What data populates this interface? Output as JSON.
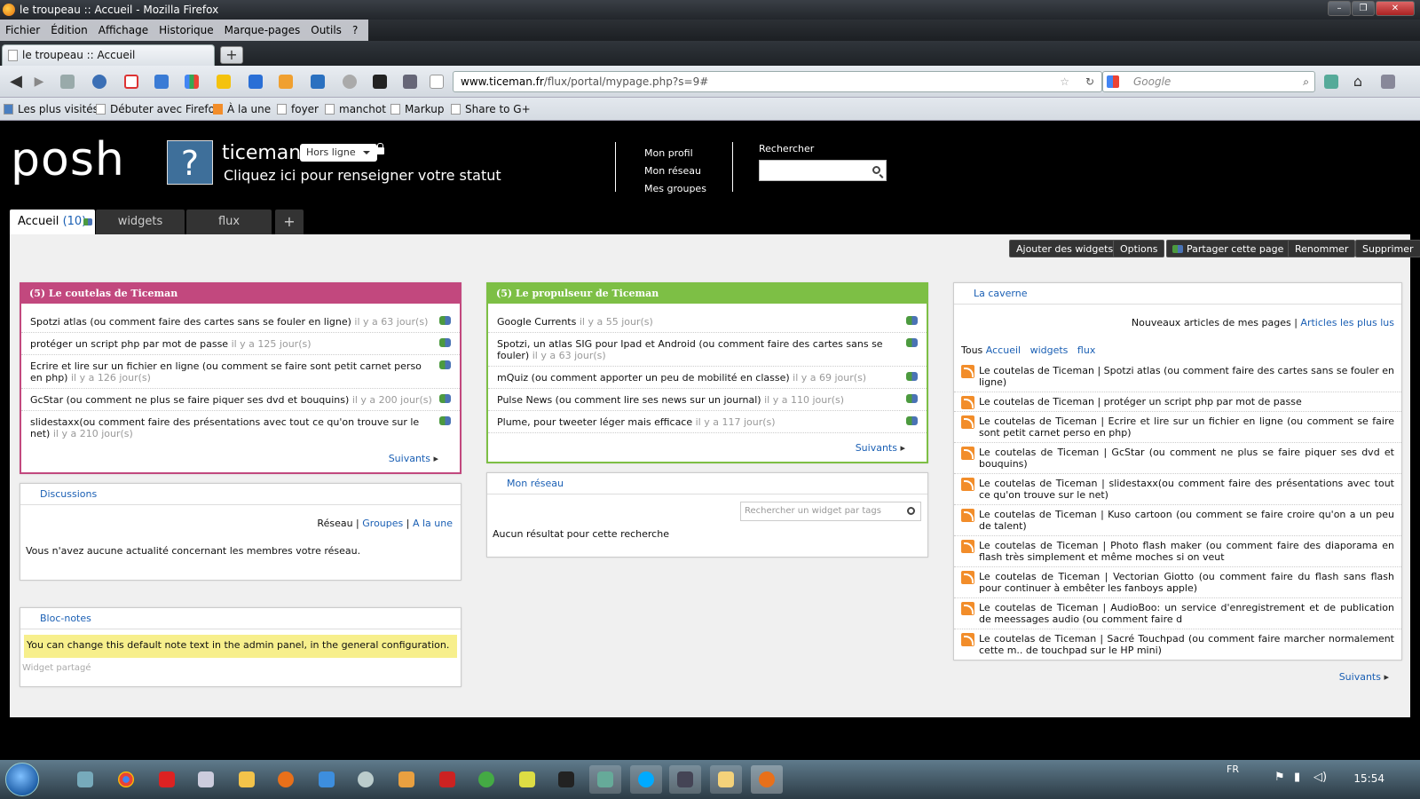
{
  "window": {
    "title": "le troupeau :: Accueil - Mozilla Firefox"
  },
  "menu": [
    "Fichier",
    "Édition",
    "Affichage",
    "Historique",
    "Marque-pages",
    "Outils",
    "?"
  ],
  "browser_tab": {
    "label": "le troupeau :: Accueil",
    "new_tab": "+"
  },
  "url": {
    "domain": "www.ticeman.fr",
    "path": "/flux/portal/mypage.php?s=9#"
  },
  "search_placeholder": "Google",
  "bookmarks": [
    "Les plus visités",
    "Débuter avec Firefox",
    "À la une",
    "foyer",
    "manchot",
    "Markup",
    "Share to G+"
  ],
  "site": {
    "logo": "posh",
    "username": "ticeman",
    "status": "Hors ligne",
    "status_prompt": "Cliquez ici pour renseigner votre statut",
    "links": [
      "Mon profil",
      "Mon réseau",
      "Mes groupes"
    ],
    "search_label": "Rechercher"
  },
  "tabs": [
    {
      "label": "Accueil",
      "count": "(10)"
    },
    {
      "label": "widgets"
    },
    {
      "label": "flux"
    },
    {
      "label": "+"
    }
  ],
  "actions": [
    "Ajouter des widgets",
    "Options",
    "Partager cette page",
    "Renommer",
    "Supprimer"
  ],
  "widget_coutelas": {
    "title": "(5) Le coutelas de Ticeman",
    "color": "#c2487e",
    "items": [
      {
        "text": "Spotzi atlas (ou comment faire des cartes sans se fouler en ligne)",
        "age": "il y a 63 jour(s)"
      },
      {
        "text": "protéger un script php par mot de passe",
        "age": "il y a 125 jour(s)"
      },
      {
        "text": "Ecrire et lire sur un fichier en ligne (ou comment se faire sont petit carnet perso en php)",
        "age": "il y a 126 jour(s)"
      },
      {
        "text": "GcStar (ou comment ne plus se faire piquer ses dvd et bouquins)",
        "age": "il y a 200 jour(s)"
      },
      {
        "text": "slidestaxx(ou comment faire des présentations avec tout ce qu'on trouve sur le net)",
        "age": "il y a 210 jour(s)"
      }
    ],
    "more": "Suivants"
  },
  "widget_propulseur": {
    "title": "(5) Le propulseur de Ticeman",
    "color": "#7dbf45",
    "items": [
      {
        "text": "Google Currents",
        "age": "il y a 55 jour(s)"
      },
      {
        "text": "Spotzi, un atlas SIG pour Ipad et Android (ou comment faire des cartes sans se fouler)",
        "age": "il y a 63 jour(s)"
      },
      {
        "text": "mQuiz (ou comment apporter un peu de mobilité en classe)",
        "age": "il y a 69 jour(s)"
      },
      {
        "text": "Pulse News (ou comment lire ses news sur un journal)",
        "age": "il y a 110 jour(s)"
      },
      {
        "text": "Plume, pour tweeter léger mais efficace",
        "age": "il y a 117 jour(s)"
      }
    ],
    "more": "Suivants"
  },
  "widget_discussions": {
    "title": "Discussions",
    "filter_reseau": "Réseau",
    "filter_groupes": "Groupes",
    "filter_une": "A la une",
    "empty": "Vous n'avez aucune actualité concernant les membres votre réseau."
  },
  "widget_reseau": {
    "title": "Mon réseau",
    "placeholder": "Rechercher un widget par tags",
    "empty": "Aucun résultat pour cette recherche"
  },
  "widget_notes": {
    "title": "Bloc-notes",
    "note": "You can change this default note text in the admin panel, in the general configuration.",
    "shared": "Widget partagé"
  },
  "widget_caverne": {
    "title": "La caverne",
    "heading": "Nouveaux articles de mes pages",
    "heading_link": "Articles les plus lus",
    "filters": [
      "Tous",
      "Accueil",
      "widgets",
      "flux"
    ],
    "items": [
      "Le coutelas de Ticeman | Spotzi atlas (ou comment faire des cartes sans se fouler en ligne)",
      "Le coutelas de Ticeman | protéger un script php par mot de passe",
      "Le coutelas de Ticeman | Ecrire et lire sur un fichier en ligne (ou comment se faire sont petit carnet perso en php)",
      "Le coutelas de Ticeman | GcStar (ou comment ne plus se faire piquer ses dvd et bouquins)",
      "Le coutelas de Ticeman | slidestaxx(ou comment faire des présentations avec tout ce qu'on trouve sur le net)",
      "Le coutelas de Ticeman | Kuso cartoon (ou comment se faire croire qu'on a un peu de talent)",
      "Le coutelas de Ticeman | Photo flash maker (ou comment faire des diaporama en flash très simplement et même moches si on veut",
      "Le coutelas de Ticeman | Vectorian Giotto (ou comment faire du flash sans flash pour continuer à embêter les fanboys apple)",
      "Le coutelas de Ticeman | AudioBoo: un service d'enregistrement et de publication de meessages audio (ou comment faire d",
      "Le coutelas de Ticeman | Sacré Touchpad (ou comment faire marcher normalement cette m.. de touchpad sur le HP mini)"
    ],
    "more": "Suivants"
  },
  "taskbar": {
    "lang": "FR",
    "time": "15:54"
  }
}
